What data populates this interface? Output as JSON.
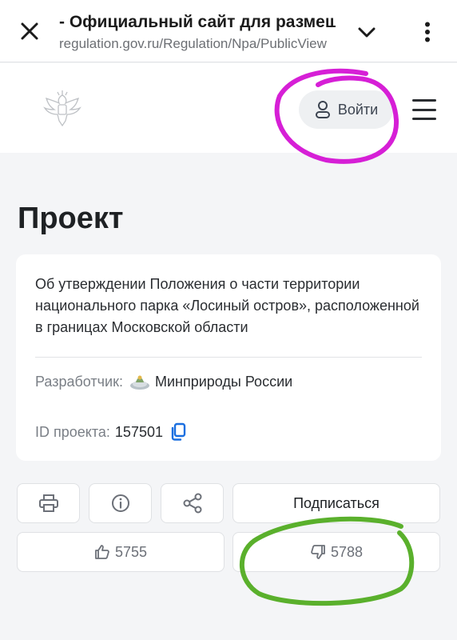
{
  "browser": {
    "title": "- Официальный сайт для размещ",
    "url": "regulation.gov.ru/Regulation/Npa/PublicView"
  },
  "header": {
    "login_label": "Войти"
  },
  "page": {
    "title": "Проект"
  },
  "project": {
    "description": "Об утверждении Положения о части территории национального парка «Лосиный остров», расположенной в границах Московской области",
    "developer_label": "Разработчик:",
    "developer_name": "Минприроды России",
    "id_label": "ID проекта:",
    "id_value": "157501"
  },
  "actions": {
    "subscribe_label": "Подписаться",
    "likes": "5755",
    "dislikes": "5788"
  },
  "colors": {
    "annotation_magenta": "#d61fd6",
    "annotation_green": "#5ab02c",
    "accent_blue": "#1a6fe0"
  },
  "icons": [
    "close-icon",
    "chevron-down-icon",
    "more-vert-icon",
    "emblem-icon",
    "user-icon",
    "menu-icon",
    "copy-icon",
    "print-icon",
    "info-icon",
    "share-icon",
    "thumb-up-icon",
    "thumb-down-icon"
  ]
}
